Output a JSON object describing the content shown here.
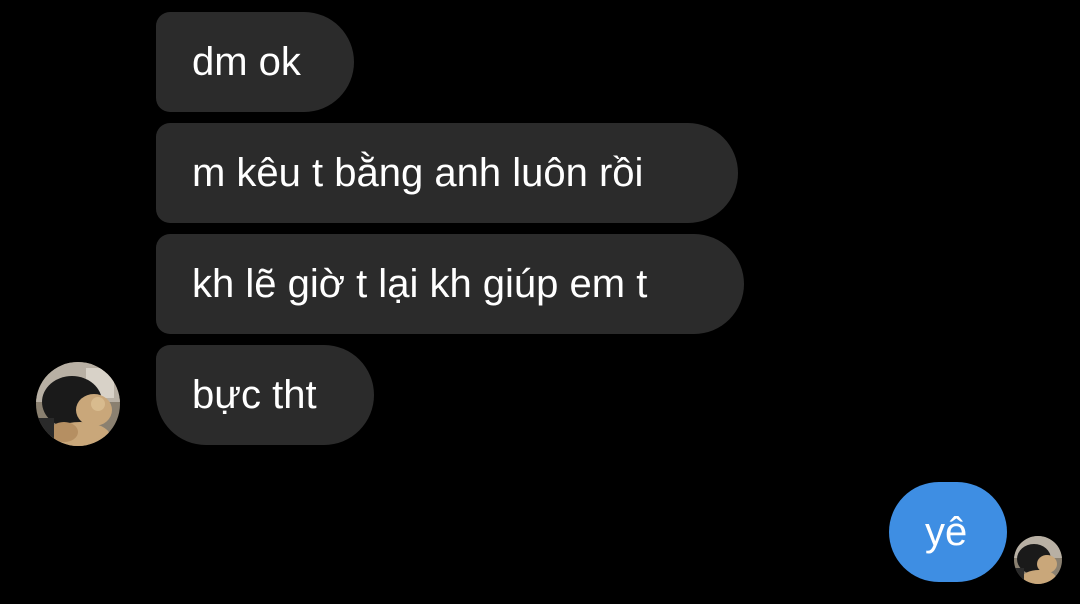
{
  "conversation": {
    "incoming": [
      {
        "text": "dm ok"
      },
      {
        "text": "m kêu t bằng anh luôn rồi"
      },
      {
        "text": "kh lẽ giờ t lại kh giúp em t"
      },
      {
        "text": "bực tht"
      }
    ],
    "outgoing": [
      {
        "text": "yê"
      }
    ]
  },
  "colors": {
    "background": "#000000",
    "incoming_bubble": "#2b2b2b",
    "outgoing_bubble": "#3e8ee3",
    "text": "#ffffff"
  },
  "icons": {
    "contact_avatar": "avatar-photo",
    "read_receipt_avatar": "avatar-photo"
  }
}
